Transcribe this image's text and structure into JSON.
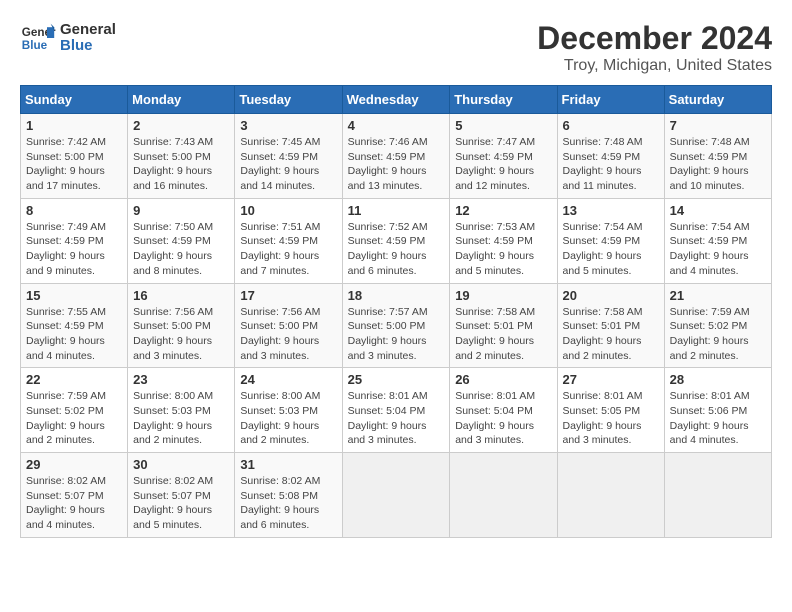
{
  "header": {
    "logo_line1": "General",
    "logo_line2": "Blue",
    "title": "December 2024",
    "subtitle": "Troy, Michigan, United States"
  },
  "calendar": {
    "days_of_week": [
      "Sunday",
      "Monday",
      "Tuesday",
      "Wednesday",
      "Thursday",
      "Friday",
      "Saturday"
    ],
    "weeks": [
      [
        {
          "num": "1",
          "info": "Sunrise: 7:42 AM\nSunset: 5:00 PM\nDaylight: 9 hours\nand 17 minutes."
        },
        {
          "num": "2",
          "info": "Sunrise: 7:43 AM\nSunset: 5:00 PM\nDaylight: 9 hours\nand 16 minutes."
        },
        {
          "num": "3",
          "info": "Sunrise: 7:45 AM\nSunset: 4:59 PM\nDaylight: 9 hours\nand 14 minutes."
        },
        {
          "num": "4",
          "info": "Sunrise: 7:46 AM\nSunset: 4:59 PM\nDaylight: 9 hours\nand 13 minutes."
        },
        {
          "num": "5",
          "info": "Sunrise: 7:47 AM\nSunset: 4:59 PM\nDaylight: 9 hours\nand 12 minutes."
        },
        {
          "num": "6",
          "info": "Sunrise: 7:48 AM\nSunset: 4:59 PM\nDaylight: 9 hours\nand 11 minutes."
        },
        {
          "num": "7",
          "info": "Sunrise: 7:48 AM\nSunset: 4:59 PM\nDaylight: 9 hours\nand 10 minutes."
        }
      ],
      [
        {
          "num": "8",
          "info": "Sunrise: 7:49 AM\nSunset: 4:59 PM\nDaylight: 9 hours\nand 9 minutes."
        },
        {
          "num": "9",
          "info": "Sunrise: 7:50 AM\nSunset: 4:59 PM\nDaylight: 9 hours\nand 8 minutes."
        },
        {
          "num": "10",
          "info": "Sunrise: 7:51 AM\nSunset: 4:59 PM\nDaylight: 9 hours\nand 7 minutes."
        },
        {
          "num": "11",
          "info": "Sunrise: 7:52 AM\nSunset: 4:59 PM\nDaylight: 9 hours\nand 6 minutes."
        },
        {
          "num": "12",
          "info": "Sunrise: 7:53 AM\nSunset: 4:59 PM\nDaylight: 9 hours\nand 5 minutes."
        },
        {
          "num": "13",
          "info": "Sunrise: 7:54 AM\nSunset: 4:59 PM\nDaylight: 9 hours\nand 5 minutes."
        },
        {
          "num": "14",
          "info": "Sunrise: 7:54 AM\nSunset: 4:59 PM\nDaylight: 9 hours\nand 4 minutes."
        }
      ],
      [
        {
          "num": "15",
          "info": "Sunrise: 7:55 AM\nSunset: 4:59 PM\nDaylight: 9 hours\nand 4 minutes."
        },
        {
          "num": "16",
          "info": "Sunrise: 7:56 AM\nSunset: 5:00 PM\nDaylight: 9 hours\nand 3 minutes."
        },
        {
          "num": "17",
          "info": "Sunrise: 7:56 AM\nSunset: 5:00 PM\nDaylight: 9 hours\nand 3 minutes."
        },
        {
          "num": "18",
          "info": "Sunrise: 7:57 AM\nSunset: 5:00 PM\nDaylight: 9 hours\nand 3 minutes."
        },
        {
          "num": "19",
          "info": "Sunrise: 7:58 AM\nSunset: 5:01 PM\nDaylight: 9 hours\nand 2 minutes."
        },
        {
          "num": "20",
          "info": "Sunrise: 7:58 AM\nSunset: 5:01 PM\nDaylight: 9 hours\nand 2 minutes."
        },
        {
          "num": "21",
          "info": "Sunrise: 7:59 AM\nSunset: 5:02 PM\nDaylight: 9 hours\nand 2 minutes."
        }
      ],
      [
        {
          "num": "22",
          "info": "Sunrise: 7:59 AM\nSunset: 5:02 PM\nDaylight: 9 hours\nand 2 minutes."
        },
        {
          "num": "23",
          "info": "Sunrise: 8:00 AM\nSunset: 5:03 PM\nDaylight: 9 hours\nand 2 minutes."
        },
        {
          "num": "24",
          "info": "Sunrise: 8:00 AM\nSunset: 5:03 PM\nDaylight: 9 hours\nand 2 minutes."
        },
        {
          "num": "25",
          "info": "Sunrise: 8:01 AM\nSunset: 5:04 PM\nDaylight: 9 hours\nand 3 minutes."
        },
        {
          "num": "26",
          "info": "Sunrise: 8:01 AM\nSunset: 5:04 PM\nDaylight: 9 hours\nand 3 minutes."
        },
        {
          "num": "27",
          "info": "Sunrise: 8:01 AM\nSunset: 5:05 PM\nDaylight: 9 hours\nand 3 minutes."
        },
        {
          "num": "28",
          "info": "Sunrise: 8:01 AM\nSunset: 5:06 PM\nDaylight: 9 hours\nand 4 minutes."
        }
      ],
      [
        {
          "num": "29",
          "info": "Sunrise: 8:02 AM\nSunset: 5:07 PM\nDaylight: 9 hours\nand 4 minutes."
        },
        {
          "num": "30",
          "info": "Sunrise: 8:02 AM\nSunset: 5:07 PM\nDaylight: 9 hours\nand 5 minutes."
        },
        {
          "num": "31",
          "info": "Sunrise: 8:02 AM\nSunset: 5:08 PM\nDaylight: 9 hours\nand 6 minutes."
        },
        {
          "num": "",
          "info": ""
        },
        {
          "num": "",
          "info": ""
        },
        {
          "num": "",
          "info": ""
        },
        {
          "num": "",
          "info": ""
        }
      ]
    ]
  }
}
